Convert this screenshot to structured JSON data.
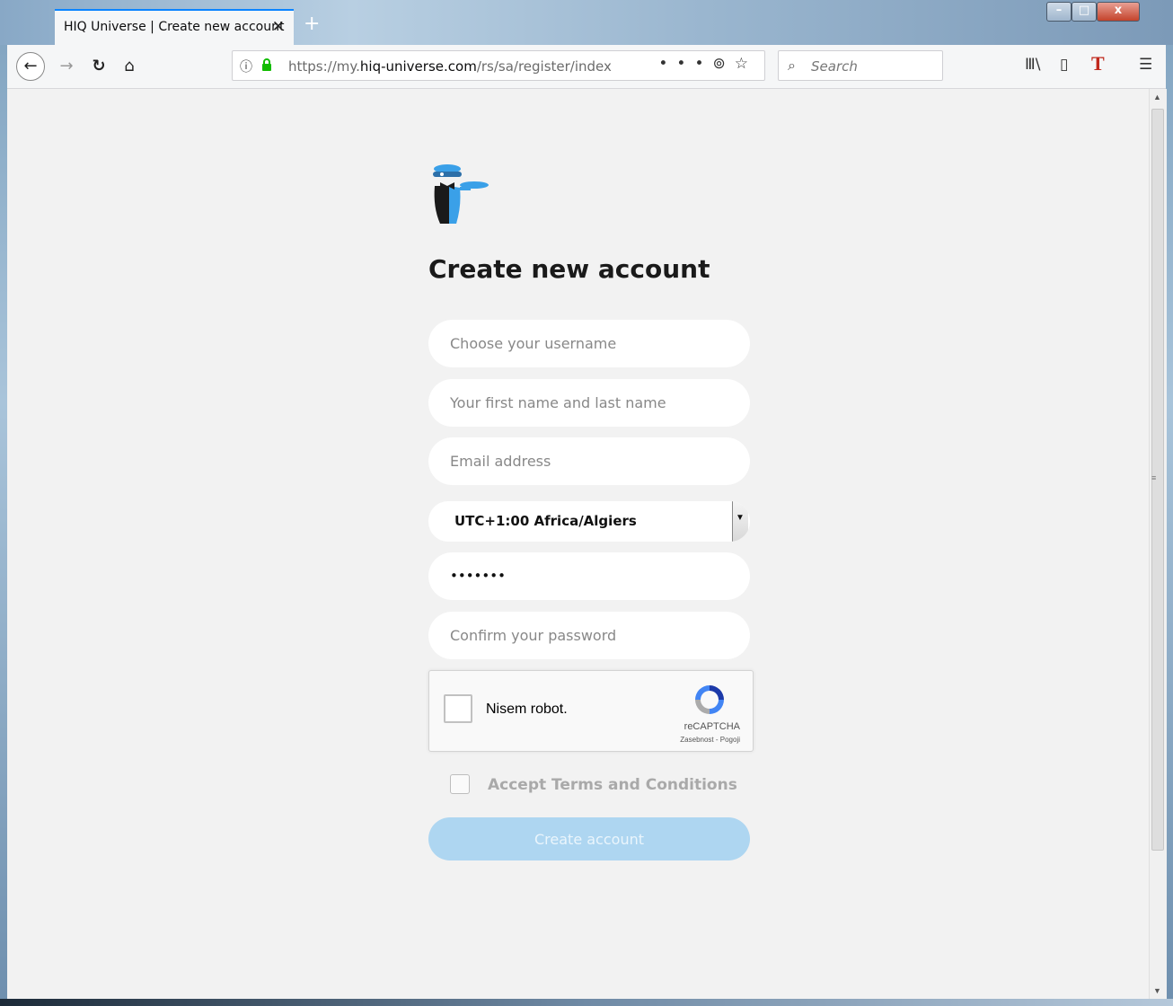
{
  "browser": {
    "tab_title": "HIQ Universe | Create new account",
    "tab_close": "✕",
    "new_tab": "+",
    "url_prefix": "https://my.",
    "url_domain": "hiq-universe.com",
    "url_path": "/rs/sa/register/index",
    "search_placeholder": "Search",
    "window_controls": {
      "minimize": "–",
      "maximize": "□",
      "close": "x"
    },
    "icons": [
      "back-arrow-icon",
      "forward-arrow-icon",
      "reload-icon",
      "home-icon",
      "info-icon",
      "lock-icon",
      "more-icon",
      "pocket-icon",
      "bookmark-star-icon",
      "search-icon",
      "library-icon",
      "sidebar-icon",
      "t-extension-icon",
      "menu-icon"
    ]
  },
  "form": {
    "title": "Create new account",
    "username_placeholder": "Choose your username",
    "fullname_placeholder": "Your first name and last name",
    "email_placeholder": "Email address",
    "timezone_selected": "UTC+1:00 Africa/Algiers",
    "password_value": "•••••••",
    "confirm_placeholder": "Confirm your password",
    "recaptcha": {
      "label": "Nisem robot.",
      "brand": "reCAPTCHA",
      "links": "Zasebnost - Pogoji"
    },
    "terms_label": "Accept Terms and Conditions",
    "submit_label": "Create account"
  },
  "colors": {
    "accent": "#0a84ff",
    "logo_blue": "#3aa0e8",
    "button_disabled": "#aed6f1",
    "page_bg": "#f2f2f2"
  }
}
